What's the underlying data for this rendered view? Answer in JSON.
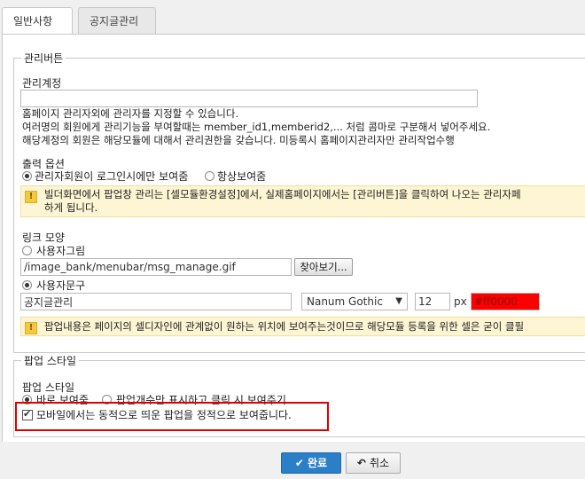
{
  "tabs": [
    {
      "label": "일반사항",
      "active": true
    },
    {
      "label": "공지글관리",
      "active": false
    }
  ],
  "admin_section": {
    "legend": "관리버튼",
    "account_label": "관리계정",
    "account_value": "",
    "desc_lines": [
      "홈페이지 관리자외에 관리자를 지정할 수 있습니다.",
      "여러명의 회원에게 관리기능을 부여할때는 member_id1,memberid2,... 처럼 콤마로 구분해서 넣어주세요.",
      "해당계정의 회원은 해당모듈에 대해서 관리권한을 갖습니다. 미등록시 홈페이지관리자만 관리작업수행"
    ],
    "output_label": "출력 옵션",
    "output_options": [
      {
        "label": "관리자회원이 로그인시에만 보여줌",
        "selected": true
      },
      {
        "label": "항상보여줌",
        "selected": false
      }
    ],
    "notice1_lines": [
      "빌더화면에서 팝업창 관리는 [셀모듈환경설정]에서, 실제홈페이지에서는 [관리버튼]을 클릭하여 나오는 관리자페",
      "하게 됩니다."
    ],
    "link_label": "링크 모양",
    "image_option": {
      "label": "사용자그림",
      "selected": false
    },
    "image_path": "/image_bank/menubar/msg_manage.gif",
    "browse_label": "찾아보기...",
    "text_option": {
      "label": "사용자문구",
      "selected": true
    },
    "text_value": "공지글관리",
    "font_select": "Nanum Gothic",
    "font_size": "12",
    "font_unit": "px",
    "color_value": "#ff0000",
    "notice2": "팝업내용은 페이지의 셀디자인에 관계없이 원하는 위치에 보여주는것이므로 해당모듈 등록을 위한 셀은 굳이 클필"
  },
  "popup_section": {
    "legend": "팝업 스타일",
    "style_label": "팝업 스타일",
    "options": [
      {
        "label": "바로 보여줌",
        "selected": true
      },
      {
        "label": "팝업개수만 표시하고 클릭 시 보여주기",
        "selected": false
      }
    ],
    "mobile_checkbox": {
      "label": "모바일에서는 동적으로 띄운 팝업을 정적으로 보여줍니다.",
      "checked": true
    }
  },
  "footer": {
    "ok_label": "완료",
    "cancel_label": "취소"
  },
  "icons": {
    "warning": "exclamation-icon",
    "ok": "check-icon",
    "cancel": "undo-icon",
    "select": "caret-down-icon"
  },
  "colors": {
    "primary": "#2a7fc6",
    "notice_bg": "#fdf5d3",
    "highlight": "#e00000",
    "color_swatch": "#ff0000"
  }
}
